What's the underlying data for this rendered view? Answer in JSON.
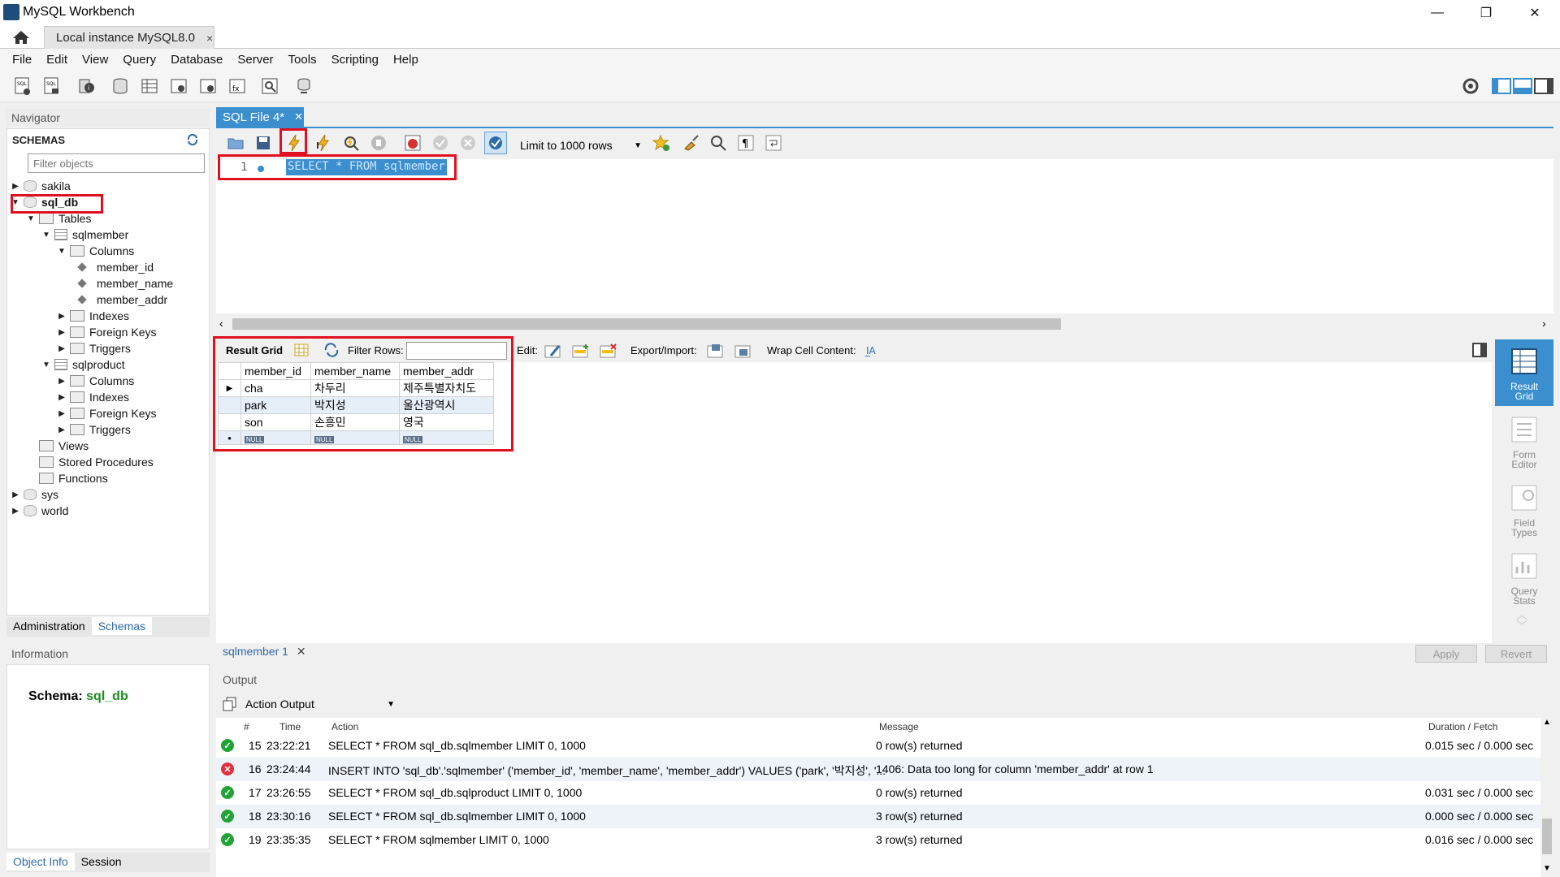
{
  "window": {
    "title": "MySQL Workbench",
    "minimize": "—",
    "maximize": "❐",
    "close": "✕"
  },
  "tabs": {
    "connection": "Local instance MySQL8.0",
    "close": "×"
  },
  "menu": [
    "File",
    "Edit",
    "View",
    "Query",
    "Database",
    "Server",
    "Tools",
    "Scripting",
    "Help"
  ],
  "navigator": {
    "header": "Navigator",
    "schemas_title": "SCHEMAS",
    "filter_placeholder": "Filter objects",
    "tree": [
      {
        "label": "sakila",
        "level": 0,
        "type": "db",
        "expanded": false
      },
      {
        "label": "sql_db",
        "level": 0,
        "type": "db",
        "expanded": true,
        "bold": true
      },
      {
        "label": "Tables",
        "level": 1,
        "type": "folder",
        "expanded": true
      },
      {
        "label": "sqlmember",
        "level": 2,
        "type": "table",
        "expanded": true
      },
      {
        "label": "Columns",
        "level": 3,
        "type": "folder",
        "expanded": true
      },
      {
        "label": "member_id",
        "level": 4,
        "type": "column"
      },
      {
        "label": "member_name",
        "level": 4,
        "type": "column"
      },
      {
        "label": "member_addr",
        "level": 4,
        "type": "column"
      },
      {
        "label": "Indexes",
        "level": 3,
        "type": "folder",
        "expanded": false
      },
      {
        "label": "Foreign Keys",
        "level": 3,
        "type": "folder",
        "expanded": false
      },
      {
        "label": "Triggers",
        "level": 3,
        "type": "folder",
        "expanded": false
      },
      {
        "label": "sqlproduct",
        "level": 2,
        "type": "table",
        "expanded": true
      },
      {
        "label": "Columns",
        "level": 3,
        "type": "folder",
        "expanded": false
      },
      {
        "label": "Indexes",
        "level": 3,
        "type": "folder",
        "expanded": false
      },
      {
        "label": "Foreign Keys",
        "level": 3,
        "type": "folder",
        "expanded": false
      },
      {
        "label": "Triggers",
        "level": 3,
        "type": "folder",
        "expanded": false
      },
      {
        "label": "Views",
        "level": 1,
        "type": "folder",
        "leaf": true
      },
      {
        "label": "Stored Procedures",
        "level": 1,
        "type": "folder",
        "leaf": true
      },
      {
        "label": "Functions",
        "level": 1,
        "type": "folder",
        "leaf": true
      },
      {
        "label": "sys",
        "level": 0,
        "type": "db",
        "expanded": false
      },
      {
        "label": "world",
        "level": 0,
        "type": "db",
        "expanded": false
      }
    ],
    "bottom_tabs": [
      "Administration",
      "Schemas"
    ],
    "info_header": "Information",
    "schema_label": "Schema:",
    "schema_value": "sql_db",
    "info_tabs": [
      "Object Info",
      "Session"
    ]
  },
  "editor": {
    "tab_label": "SQL File 4*",
    "limit_select": "Limit to 1000 rows",
    "line_number": "1",
    "query": "SELECT * FROM sqlmember"
  },
  "results": {
    "result_grid_label": "Result Grid",
    "filter_rows_label": "Filter Rows:",
    "edit_label": "Edit:",
    "export_label": "Export/Import:",
    "wrap_label": "Wrap Cell Content:",
    "columns": [
      "member_id",
      "member_name",
      "member_addr"
    ],
    "rows": [
      [
        "cha",
        "차두리",
        "제주특별자치도"
      ],
      [
        "park",
        "박지성",
        "울산광역시"
      ],
      [
        "son",
        "손흥민",
        "영국"
      ]
    ],
    "null_badge": "NULL",
    "side_buttons": [
      "Result Grid",
      "Form Editor",
      "Field Types",
      "Query Stats"
    ],
    "result_tab": "sqlmember 1",
    "apply": "Apply",
    "revert": "Revert"
  },
  "output": {
    "header": "Output",
    "selector": "Action Output",
    "columns": [
      "#",
      "Time",
      "Action",
      "Message",
      "Duration / Fetch"
    ],
    "rows": [
      {
        "status": "ok",
        "num": "15",
        "time": "23:22:21",
        "action": "SELECT * FROM sql_db.sqlmember LIMIT 0, 1000",
        "message": "0 row(s) returned",
        "duration": "0.015 sec / 0.000 sec"
      },
      {
        "status": "error",
        "num": "16",
        "time": "23:24:44",
        "action": "INSERT INTO 'sql_db'.'sqlmember' ('member_id', 'member_name', 'member_addr') VALUES ('park', '박지성', '...",
        "message": "1406: Data too long for column 'member_addr' at row 1",
        "duration": ""
      },
      {
        "status": "ok",
        "num": "17",
        "time": "23:26:55",
        "action": "SELECT * FROM sql_db.sqlproduct LIMIT 0, 1000",
        "message": "0 row(s) returned",
        "duration": "0.031 sec / 0.000 sec"
      },
      {
        "status": "ok",
        "num": "18",
        "time": "23:30:16",
        "action": "SELECT * FROM sql_db.sqlmember LIMIT 0, 1000",
        "message": "3 row(s) returned",
        "duration": "0.000 sec / 0.000 sec"
      },
      {
        "status": "ok",
        "num": "19",
        "time": "23:35:35",
        "action": "SELECT * FROM sqlmember LIMIT 0, 1000",
        "message": "3 row(s) returned",
        "duration": "0.016 sec / 0.000 sec"
      }
    ]
  },
  "colors": {
    "accent": "#3b8fcf",
    "highlight": "#e01020",
    "ok": "#21a336",
    "error": "#e0303a",
    "schema_green": "#1a8f1a"
  }
}
